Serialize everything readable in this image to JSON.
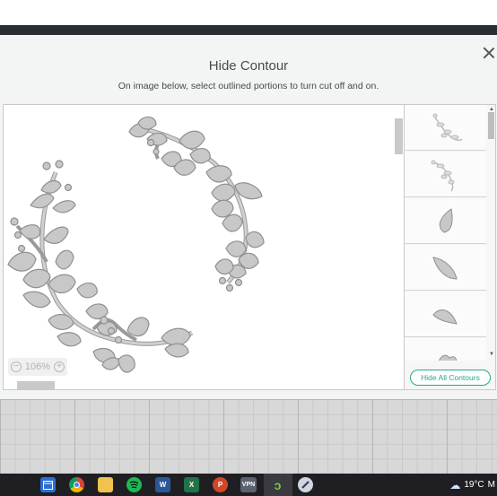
{
  "dialog": {
    "title": "Hide Contour",
    "subtitle": "On image below, select outlined portions to turn cut off and on.",
    "hide_all_label": "Hide All Contours"
  },
  "canvas": {
    "zoom": "106%",
    "zoom_minus": "−",
    "zoom_plus": "+"
  },
  "contour_list": {
    "items": [
      {
        "name": "wreath-branch-left"
      },
      {
        "name": "wreath-branch-right"
      },
      {
        "name": "leaf-1"
      },
      {
        "name": "leaf-2"
      },
      {
        "name": "leaf-3"
      },
      {
        "name": "leaf-4"
      }
    ]
  },
  "taskbar": {
    "apps": [
      "calendar",
      "chrome",
      "file-explorer",
      "spotify",
      "word",
      "excel",
      "powerpoint",
      "vpn",
      "design-space",
      "other"
    ],
    "vpn_label": "VPN",
    "word_label": "W",
    "excel_label": "X",
    "powerpoint_label": "P",
    "weather": "19°C",
    "weather_trailing": "M"
  },
  "colors": {
    "accent": "#27a88a",
    "leaf_fill": "#c8c8c8",
    "leaf_stroke": "#8f8f8f",
    "taskbar": "#1f1f23"
  }
}
